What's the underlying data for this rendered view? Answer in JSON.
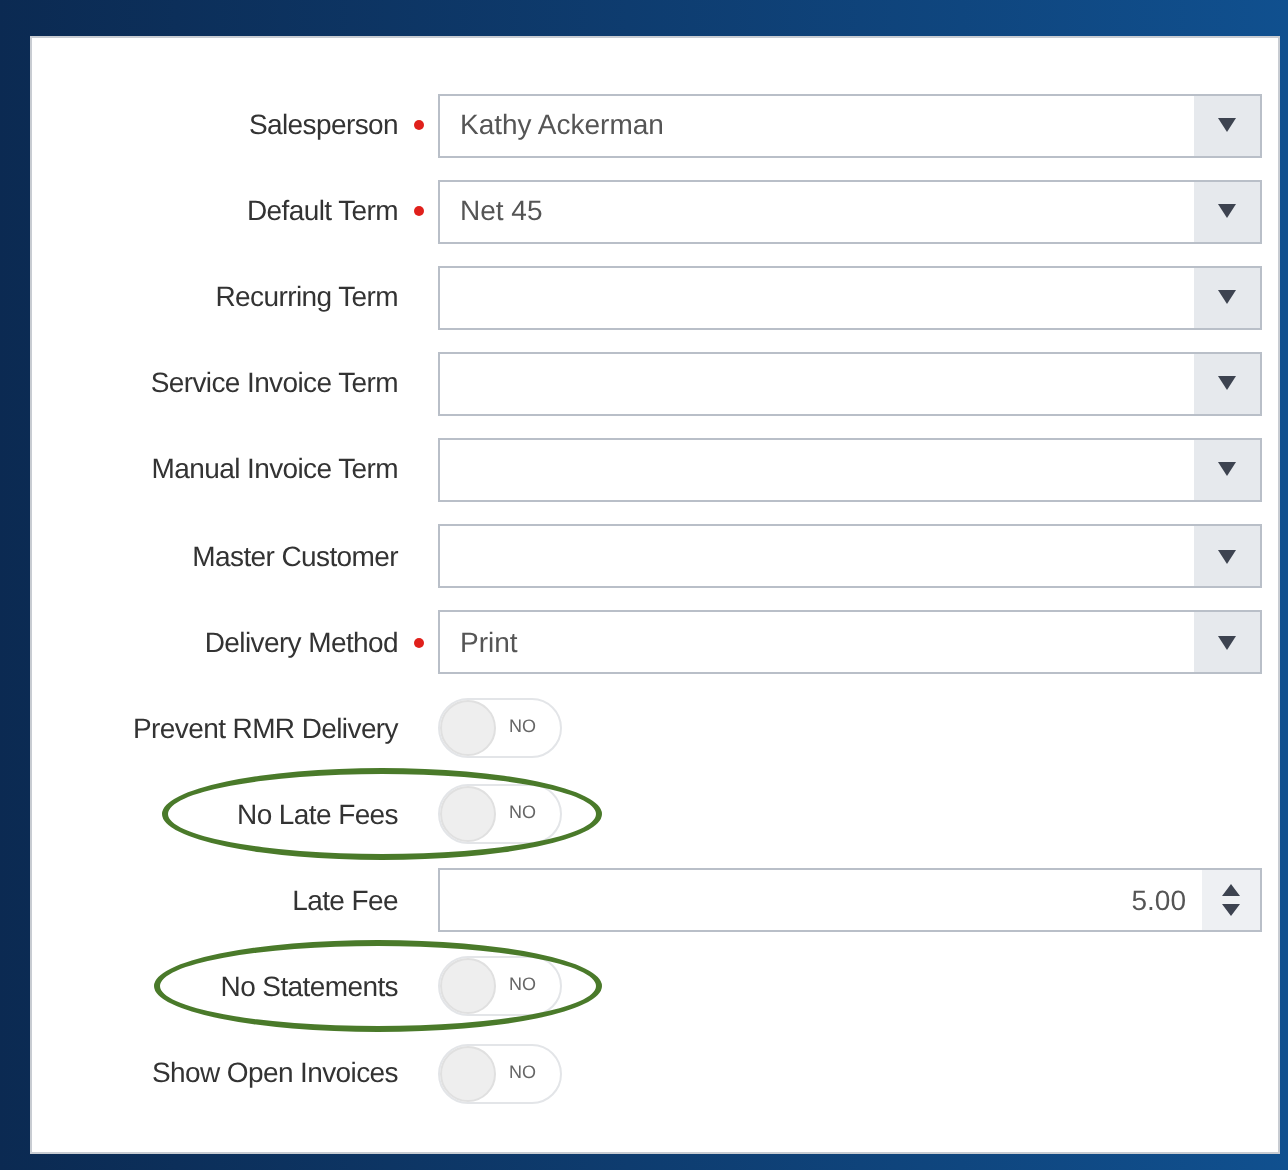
{
  "fields": [
    {
      "kind": "select",
      "label": "Salesperson",
      "required": true,
      "value": "Kathy Ackerman",
      "highlighted": false
    },
    {
      "kind": "select",
      "label": "Default Term",
      "required": true,
      "value": "Net 45",
      "highlighted": false
    },
    {
      "kind": "select",
      "label": "Recurring Term",
      "required": false,
      "highlighted": false
    },
    {
      "kind": "select",
      "label": "Service Invoice Term",
      "required": false,
      "highlighted": false
    },
    {
      "kind": "select",
      "label": "Manual Invoice Term",
      "required": false,
      "highlighted": false
    },
    {
      "kind": "select",
      "label": "Master Customer",
      "required": false,
      "highlighted": false
    },
    {
      "kind": "select",
      "label": "Delivery Method",
      "required": true,
      "value": "Print",
      "highlighted": false
    },
    {
      "kind": "toggle",
      "label": "Prevent RMR Delivery",
      "required": false,
      "on": false,
      "state_text": "NO",
      "highlighted": false
    },
    {
      "kind": "toggle",
      "label": "No Late Fees",
      "required": false,
      "on": false,
      "state_text": "NO",
      "highlighted": true
    },
    {
      "kind": "number",
      "label": "Late Fee",
      "required": false,
      "value": "5.00",
      "highlighted": false
    },
    {
      "kind": "toggle",
      "label": "No Statements",
      "required": false,
      "on": false,
      "state_text": "NO",
      "highlighted": true
    },
    {
      "kind": "toggle",
      "label": "Show Open Invoices",
      "required": false,
      "on": false,
      "state_text": "NO",
      "highlighted": false
    }
  ]
}
